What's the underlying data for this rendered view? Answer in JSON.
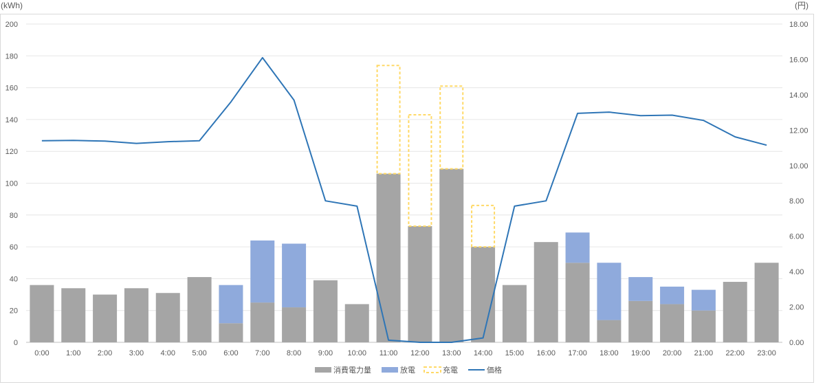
{
  "chart_data": {
    "type": "bar",
    "y_left_unit": "(kWh)",
    "y_right_unit": "(円)",
    "ylim_left": [
      0,
      200
    ],
    "yticks_left": [
      "0",
      "20",
      "40",
      "60",
      "80",
      "100",
      "120",
      "140",
      "160",
      "180",
      "200"
    ],
    "ylim_right": [
      0,
      18
    ],
    "yticks_right": [
      "0.00",
      "2.00",
      "4.00",
      "6.00",
      "8.00",
      "10.00",
      "12.00",
      "14.00",
      "16.00",
      "18.00"
    ],
    "grid": true,
    "legend_position": "bottom",
    "categories": [
      "0:00",
      "1:00",
      "2:00",
      "3:00",
      "4:00",
      "5:00",
      "6:00",
      "7:00",
      "8:00",
      "9:00",
      "10:00",
      "11:00",
      "12:00",
      "13:00",
      "14:00",
      "15:00",
      "16:00",
      "17:00",
      "18:00",
      "19:00",
      "20:00",
      "21:00",
      "22:00",
      "23:00"
    ],
    "series": [
      {
        "name": "消費電力量",
        "kind": "bar",
        "color": "#a5a5a5",
        "values": [
          36,
          34,
          30,
          34,
          31,
          41,
          12,
          25,
          22,
          39,
          24,
          106,
          73,
          109,
          60,
          36,
          63,
          50,
          14,
          26,
          24,
          20,
          38,
          50
        ]
      },
      {
        "name": "放電",
        "kind": "bar-stacked",
        "color": "#8faadc",
        "values": [
          0,
          0,
          0,
          0,
          0,
          0,
          24,
          39,
          40,
          0,
          0,
          0,
          0,
          0,
          0,
          0,
          0,
          19,
          36,
          15,
          11,
          13,
          0,
          0
        ]
      },
      {
        "name": "充電",
        "kind": "bar-stacked-dashed",
        "color": "#ffd966",
        "values": [
          0,
          0,
          0,
          0,
          0,
          0,
          0,
          0,
          0,
          0,
          0,
          68,
          70,
          52,
          26,
          0,
          0,
          0,
          0,
          0,
          0,
          0,
          0,
          0
        ]
      },
      {
        "name": "価格",
        "kind": "line",
        "axis": "right",
        "color": "#2e75b6",
        "values": [
          11.4,
          11.42,
          11.38,
          11.25,
          11.35,
          11.4,
          13.6,
          16.1,
          13.7,
          8.0,
          7.7,
          0.12,
          0.0,
          0.0,
          0.25,
          7.7,
          8.0,
          12.95,
          13.02,
          12.82,
          12.85,
          12.55,
          11.62,
          11.15
        ]
      }
    ]
  }
}
